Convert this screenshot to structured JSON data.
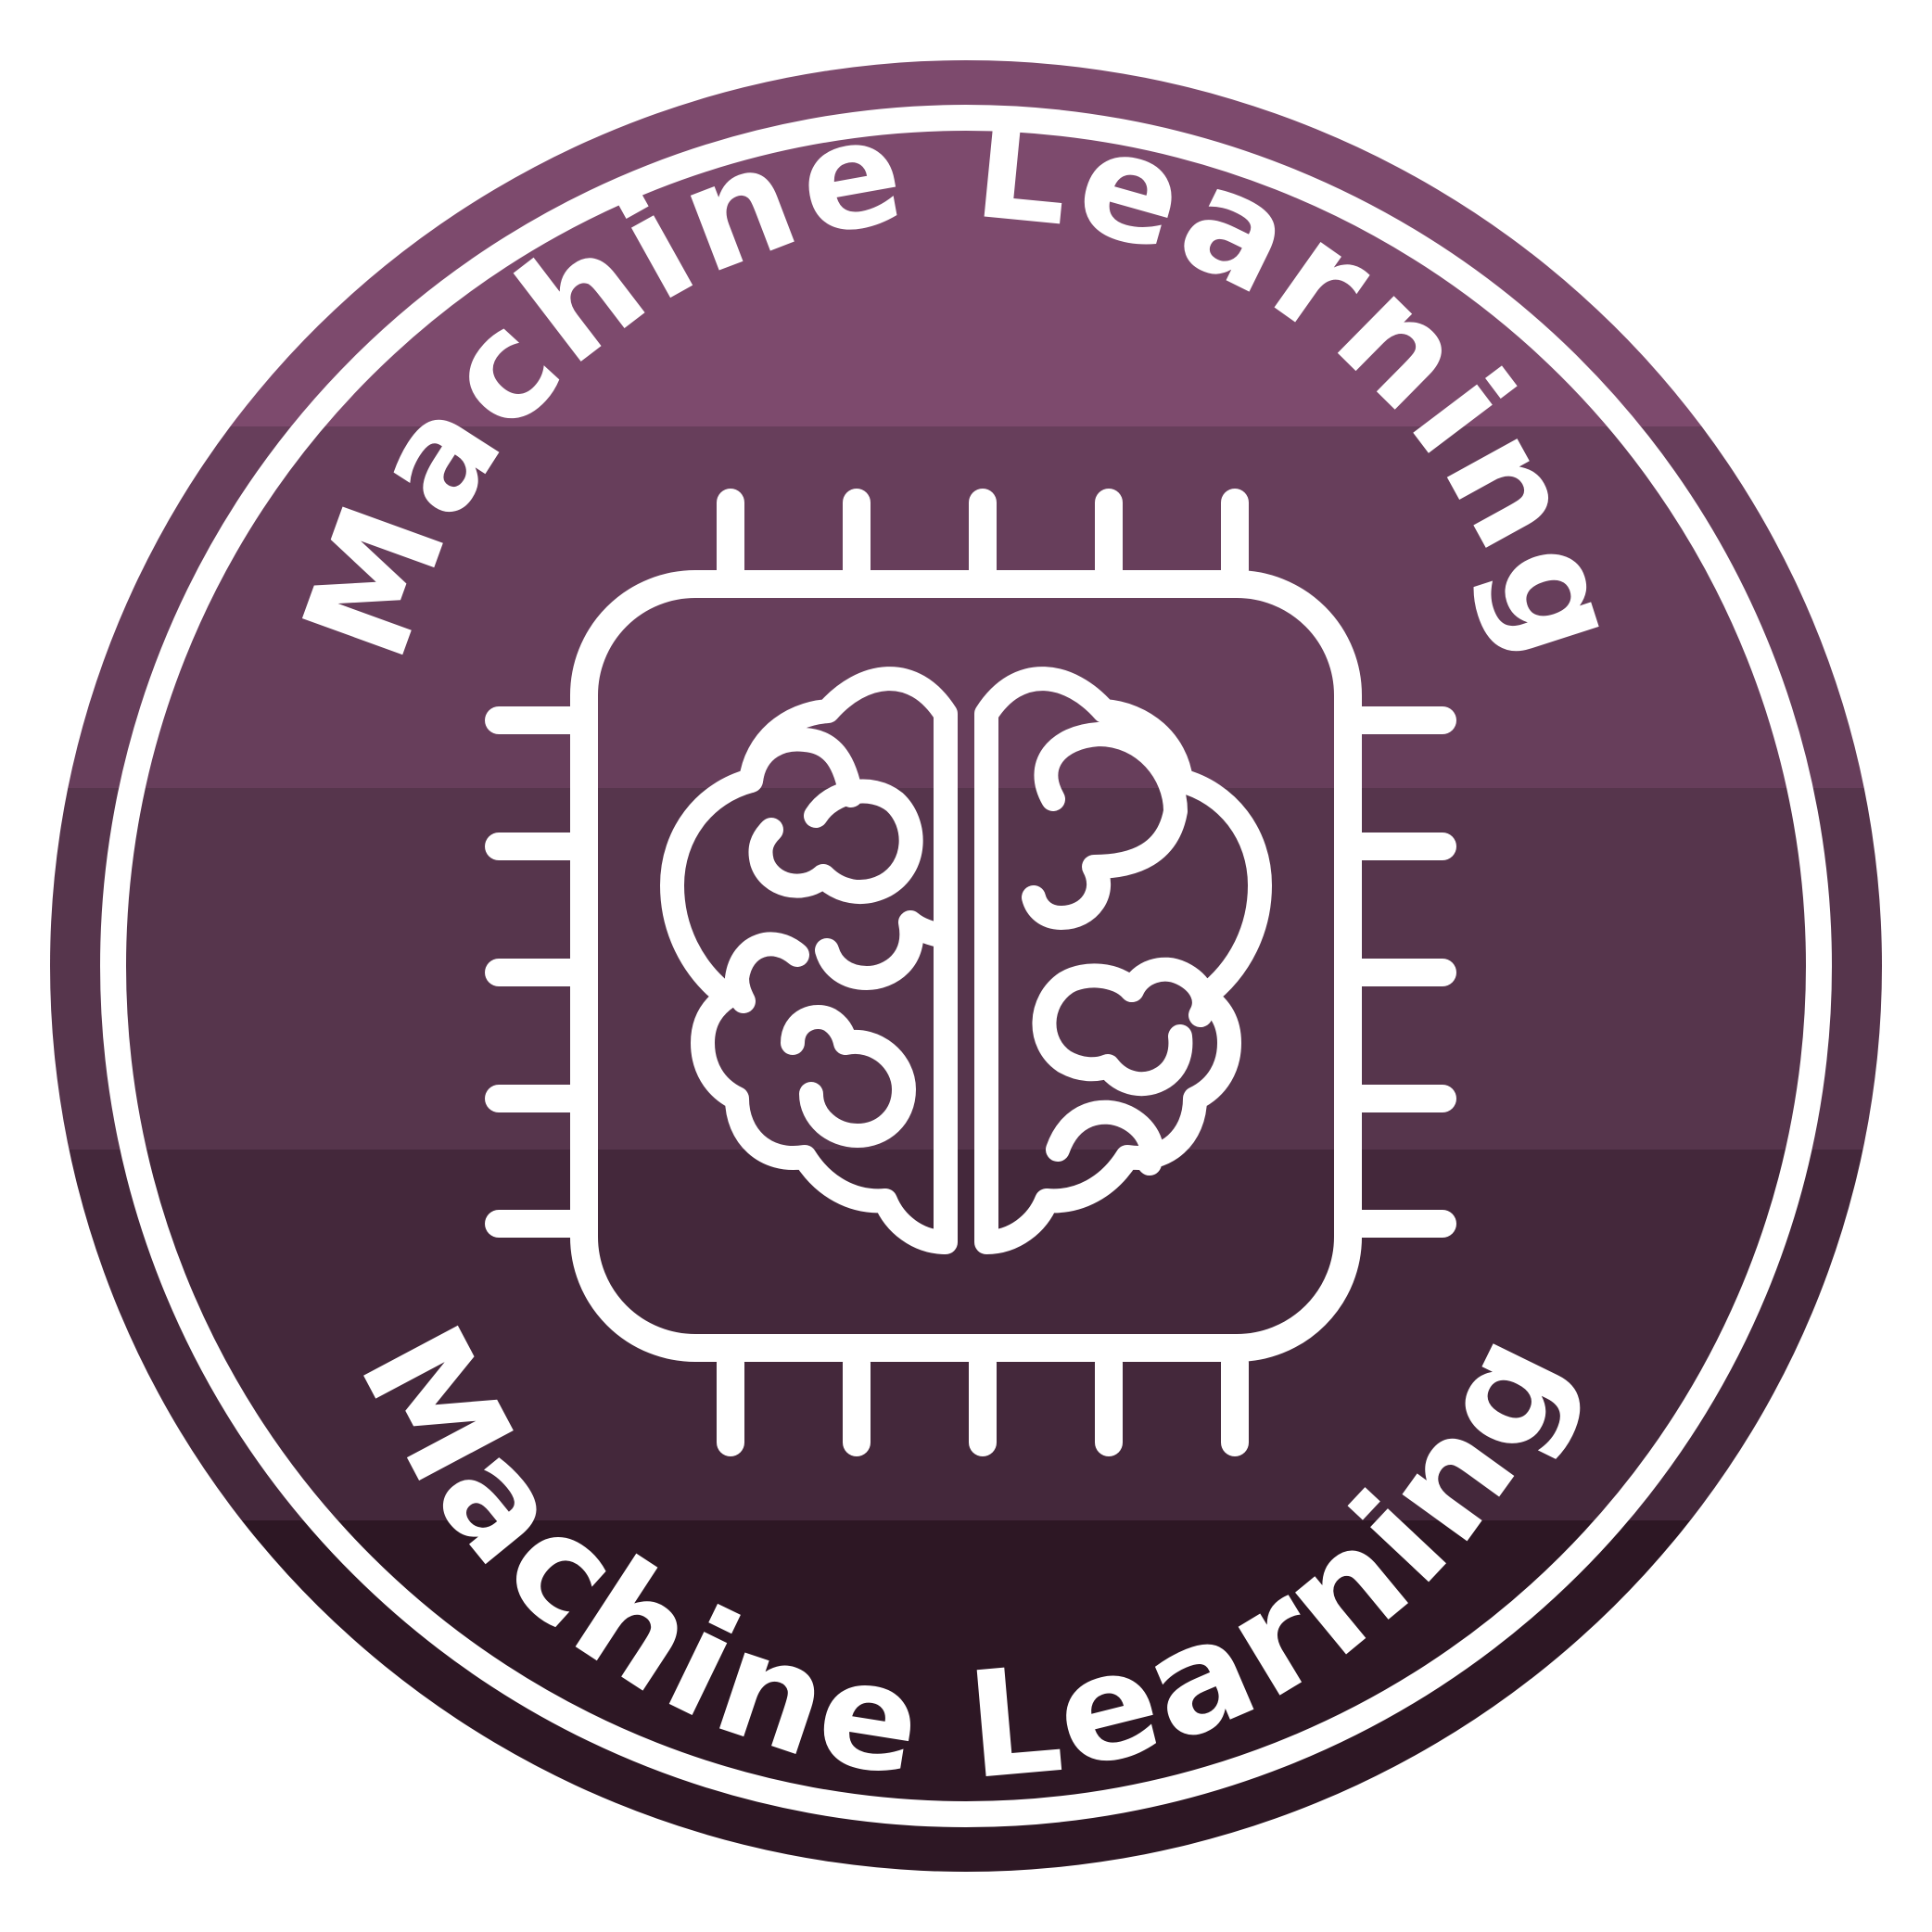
{
  "badge": {
    "top_text": "Machine Learning",
    "bottom_text": "Machine Learning",
    "icons": {
      "chip": "microchip-icon",
      "brain": "brain-icon"
    },
    "colors": {
      "bands": [
        "#7d4a6d",
        "#673e5b",
        "#56354c",
        "#44283b",
        "#2d1724"
      ],
      "ring": "#ffffff",
      "icon": "#ffffff"
    }
  }
}
